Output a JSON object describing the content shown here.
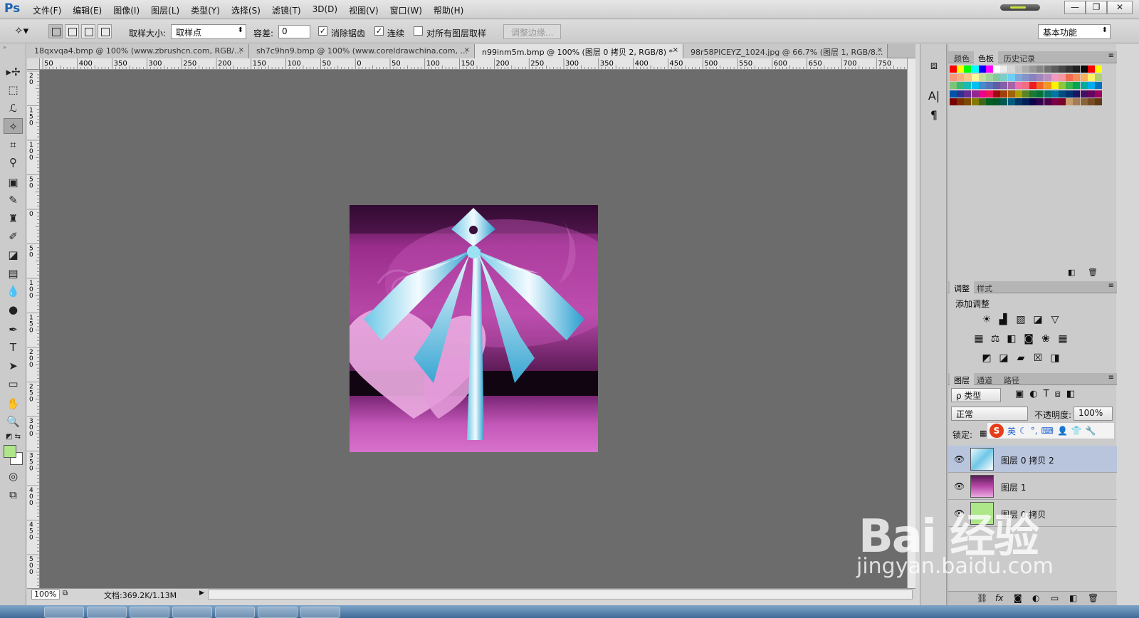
{
  "app": {
    "logo": "Ps"
  },
  "menu": [
    "文件(F)",
    "编辑(E)",
    "图像(I)",
    "图层(L)",
    "类型(Y)",
    "选择(S)",
    "滤镜(T)",
    "3D(D)",
    "视图(V)",
    "窗口(W)",
    "帮助(H)"
  ],
  "window": {
    "minimize": "—",
    "restore": "❐",
    "close": "✕"
  },
  "options": {
    "sample_size_label": "取样大小:",
    "sample_size_value": "取样点",
    "tolerance_label": "容差:",
    "tolerance_value": "0",
    "antialias_label": "消除锯齿",
    "antialias_checked": true,
    "contiguous_label": "连续",
    "contiguous_checked": true,
    "sample_all_label": "对所有图层取样",
    "sample_all_checked": false,
    "refine_edge_label": "调整边缘...",
    "workspace": "基本功能"
  },
  "tabs": [
    {
      "label": "18qxvqa4.bmp @ 100% (www.zbrushcn.com, RGB/...",
      "close": "×"
    },
    {
      "label": "sh7c9hn9.bmp @ 100% (www.coreldrawchina.com, ...",
      "close": "×"
    },
    {
      "label": "n99inm5m.bmp @ 100% (图层 0 拷贝 2, RGB/8) *",
      "close": "×",
      "active": true
    },
    {
      "label": "98r58PICEYZ_1024.jpg @ 66.7% (图层 1, RGB/8...",
      "close": "×"
    }
  ],
  "ruler_h": [
    "50",
    "400",
    "350",
    "300",
    "250",
    "200",
    "150",
    "100",
    "50",
    "0",
    "50",
    "100",
    "150",
    "200",
    "250",
    "300",
    "350",
    "400",
    "450",
    "500",
    "550",
    "600",
    "650",
    "700",
    "750"
  ],
  "ruler_v": [
    "2 0",
    "1 5 0",
    "1 0 0",
    "5 0",
    "0",
    "5 0",
    "1 0 0",
    "1 5 0",
    "2 0 0",
    "2 5 0",
    "3 0 0",
    "3 5 0",
    "4 0 0",
    "4 5 0",
    "5 0 0",
    "5 5"
  ],
  "status": {
    "zoom": "100%",
    "doc": "文档:369.2K/1.13M"
  },
  "colors": {
    "foreground": "#aee68a",
    "background": "#ffffff",
    "canvas": "#6c6c6c"
  },
  "swatch_panel": {
    "tabs": [
      "颜色",
      "色板",
      "历史记录"
    ],
    "active": 1
  },
  "swatch_colors": [
    [
      "#ff0000",
      "#ffff00",
      "#00ff00",
      "#00ffff",
      "#0000ff",
      "#ff00ff",
      "#ffffff",
      "#ebebeb",
      "#d6d6d6",
      "#c2c2c2",
      "#adadad",
      "#999999",
      "#858585",
      "#707070",
      "#5c5c5c",
      "#474747",
      "#333333",
      "#1f1f1f",
      "#0a0a0a",
      "#ff0000",
      "#ffff00"
    ],
    [
      "#f7977a",
      "#fbad82",
      "#fdc68a",
      "#fff79a",
      "#c4df9b",
      "#a2d39c",
      "#82ca9d",
      "#7bcdc8",
      "#6ecff6",
      "#7ea7d8",
      "#8493ca",
      "#8882be",
      "#a187be",
      "#bc8dbf",
      "#f49ac2",
      "#f6989d",
      "#f26c4f",
      "#f68e55",
      "#fbaf5c",
      "#fff467",
      "#acd372"
    ],
    [
      "#7cc576",
      "#3bb878",
      "#1abbb4",
      "#00bff3",
      "#438ccb",
      "#5574b9",
      "#605ca8",
      "#855fa8",
      "#a763a8",
      "#f06ea9",
      "#f26d7d",
      "#ed1c24",
      "#f26522",
      "#f7941d",
      "#fff200",
      "#8dc73f",
      "#39b54a",
      "#00a651",
      "#00a99d",
      "#00aeef",
      "#0072bc"
    ],
    [
      "#0054a6",
      "#2e3192",
      "#662d91",
      "#92278f",
      "#ec008c",
      "#ed145b",
      "#9e0b0f",
      "#a0410d",
      "#a36209",
      "#aba000",
      "#598527",
      "#197b30",
      "#007236",
      "#00746b",
      "#0076a3",
      "#004b80",
      "#003471",
      "#1b1464",
      "#440e62",
      "#630460",
      "#9e005d"
    ],
    [
      "#790000",
      "#7b2e00",
      "#7d4900",
      "#827b00",
      "#406618",
      "#005e20",
      "#005826",
      "#005952",
      "#005b7f",
      "#003663",
      "#002157",
      "#0d004c",
      "#32004b",
      "#4b0049",
      "#7b0046",
      "#7a0026",
      "#c69c6d",
      "#a67c52",
      "#8c6239",
      "#754c24",
      "#603913"
    ]
  ],
  "adjust_panel": {
    "tabs": [
      "调整",
      "样式"
    ],
    "title": "添加调整"
  },
  "layers_panel": {
    "tabs": [
      "图层",
      "通道",
      "路径"
    ],
    "filter_kind": "ρ 类型",
    "blend_mode": "正常",
    "opacity_label": "不透明度:",
    "opacity_value": "100%",
    "lock_label": "锁定:",
    "layers": [
      {
        "name": "图层 0 拷贝 2",
        "selected": true,
        "visible": true
      },
      {
        "name": "图层 1",
        "selected": false,
        "visible": true
      },
      {
        "name": "图层 0 拷贝",
        "selected": false,
        "visible": true
      }
    ]
  },
  "ime": {
    "logo": "S",
    "lang": "英"
  },
  "watermark": {
    "main": "Bai 经验",
    "sub": "jingyan.baidu.com"
  }
}
